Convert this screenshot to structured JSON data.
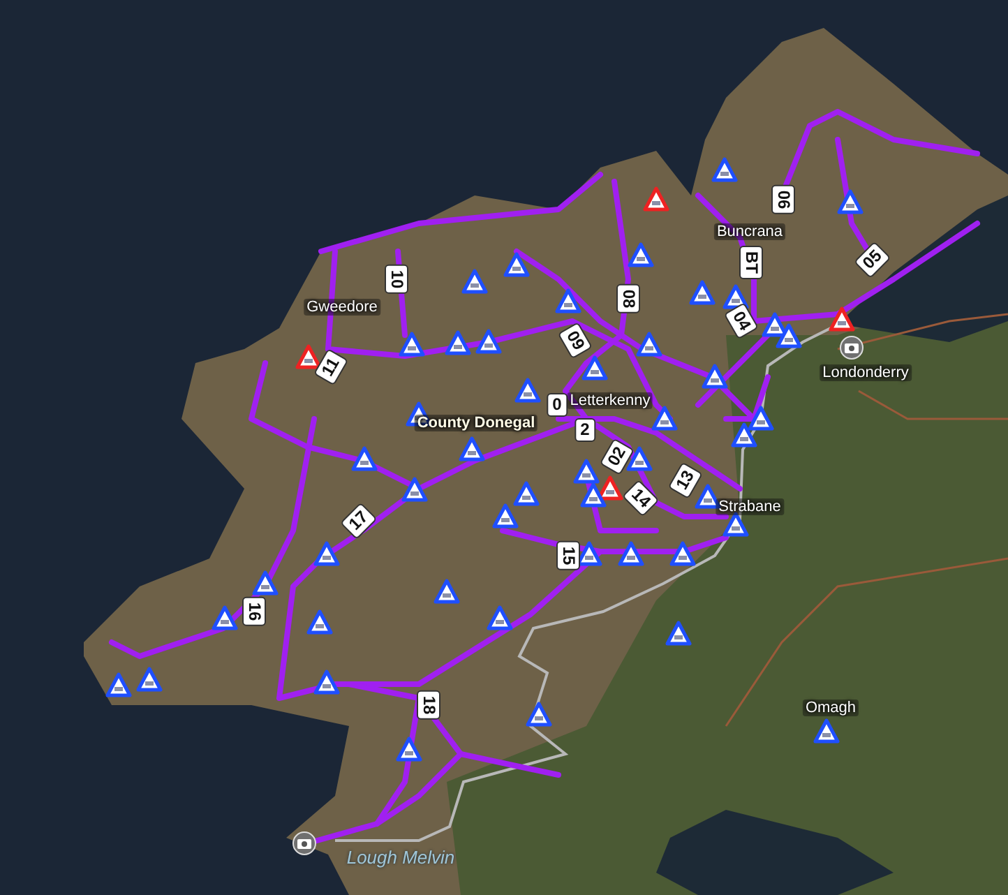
{
  "map": {
    "place_labels": [
      {
        "text": "Gweedore",
        "kind": "place"
      },
      {
        "text": "County Donegal",
        "kind": "region"
      },
      {
        "text": "Letterkenny",
        "kind": "place"
      },
      {
        "text": "Buncrana",
        "kind": "place"
      },
      {
        "text": "Londonderry",
        "kind": "place"
      },
      {
        "text": "Strabane",
        "kind": "place"
      },
      {
        "text": "Omagh",
        "kind": "place"
      },
      {
        "text": "Lough Melvin",
        "kind": "water"
      }
    ],
    "route_labels": [
      {
        "text": "10"
      },
      {
        "text": "11"
      },
      {
        "text": "09"
      },
      {
        "text": "08"
      },
      {
        "text": "06"
      },
      {
        "text": "05"
      },
      {
        "text": "BT"
      },
      {
        "text": "04"
      },
      {
        "text": "0"
      },
      {
        "text": "2"
      },
      {
        "text": "02"
      },
      {
        "text": "13"
      },
      {
        "text": "14"
      },
      {
        "text": "15"
      },
      {
        "text": "16"
      },
      {
        "text": "17"
      },
      {
        "text": "18"
      }
    ],
    "markers": [
      {
        "color": "#1f4fff"
      },
      {
        "color": "#ee2222"
      },
      {
        "color": "#1f4fff"
      },
      {
        "color": "#1f4fff"
      },
      {
        "color": "#1f4fff"
      },
      {
        "color": "#1f4fff"
      },
      {
        "color": "#1f4fff"
      },
      {
        "color": "#1f4fff"
      },
      {
        "color": "#1f4fff"
      },
      {
        "color": "#1f4fff"
      },
      {
        "color": "#1f4fff"
      },
      {
        "color": "#ee2222"
      },
      {
        "color": "#1f4fff"
      },
      {
        "color": "#1f4fff"
      },
      {
        "color": "#1f4fff"
      },
      {
        "color": "#1f4fff"
      },
      {
        "color": "#1f4fff"
      },
      {
        "color": "#1f4fff"
      },
      {
        "color": "#1f4fff"
      },
      {
        "color": "#ee2222"
      },
      {
        "color": "#1f4fff"
      },
      {
        "color": "#1f4fff"
      },
      {
        "color": "#1f4fff"
      },
      {
        "color": "#1f4fff"
      },
      {
        "color": "#1f4fff"
      },
      {
        "color": "#1f4fff"
      },
      {
        "color": "#1f4fff"
      },
      {
        "color": "#ee2222"
      },
      {
        "color": "#1f4fff"
      },
      {
        "color": "#1f4fff"
      },
      {
        "color": "#1f4fff"
      },
      {
        "color": "#1f4fff"
      },
      {
        "color": "#1f4fff"
      },
      {
        "color": "#1f4fff"
      },
      {
        "color": "#1f4fff"
      },
      {
        "color": "#1f4fff"
      },
      {
        "color": "#1f4fff"
      },
      {
        "color": "#1f4fff"
      },
      {
        "color": "#1f4fff"
      },
      {
        "color": "#1f4fff"
      },
      {
        "color": "#1f4fff"
      },
      {
        "color": "#1f4fff"
      },
      {
        "color": "#1f4fff"
      },
      {
        "color": "#1f4fff"
      },
      {
        "color": "#1f4fff"
      },
      {
        "color": "#1f4fff"
      },
      {
        "color": "#1f4fff"
      },
      {
        "color": "#1f4fff"
      },
      {
        "color": "#1f4fff"
      },
      {
        "color": "#1f4fff"
      },
      {
        "color": "#1f4fff"
      }
    ]
  }
}
